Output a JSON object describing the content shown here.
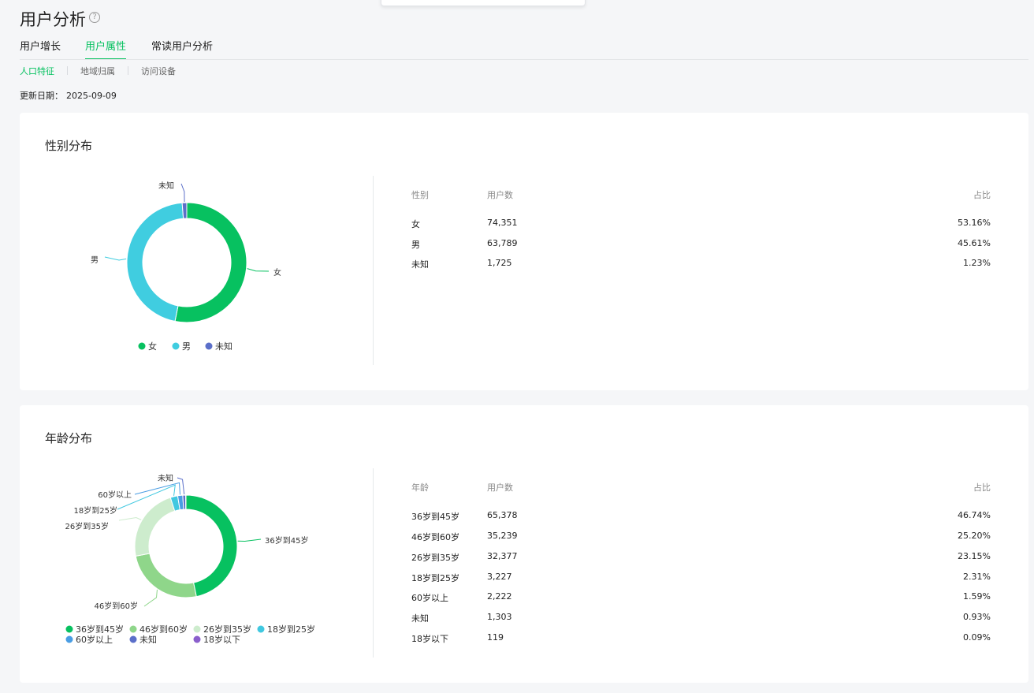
{
  "page": {
    "title": "用户分析",
    "help_icon": "?"
  },
  "tabs": [
    {
      "label": "用户增长"
    },
    {
      "label": "用户属性",
      "active": true
    },
    {
      "label": "常读用户分析"
    }
  ],
  "subtabs": [
    {
      "label": "人口特征",
      "active": true
    },
    {
      "label": "地域归属"
    },
    {
      "label": "访问设备"
    }
  ],
  "update": {
    "label": "更新日期：",
    "date": "2025-09-09"
  },
  "gender": {
    "title": "性别分布",
    "headers": {
      "category": "性别",
      "users": "用户数",
      "ratio": "占比"
    },
    "rows": [
      {
        "label": "女",
        "users": "74,351",
        "ratio": "53.16%"
      },
      {
        "label": "男",
        "users": "63,789",
        "ratio": "45.61%"
      },
      {
        "label": "未知",
        "users": "1,725",
        "ratio": "1.23%"
      }
    ]
  },
  "age": {
    "title": "年龄分布",
    "headers": {
      "category": "年龄",
      "users": "用户数",
      "ratio": "占比"
    },
    "rows": [
      {
        "label": "36岁到45岁",
        "users": "65,378",
        "ratio": "46.74%"
      },
      {
        "label": "46岁到60岁",
        "users": "35,239",
        "ratio": "25.20%"
      },
      {
        "label": "26岁到35岁",
        "users": "32,377",
        "ratio": "23.15%"
      },
      {
        "label": "18岁到25岁",
        "users": "3,227",
        "ratio": "2.31%"
      },
      {
        "label": "60岁以上",
        "users": "2,222",
        "ratio": "1.59%"
      },
      {
        "label": "未知",
        "users": "1,303",
        "ratio": "0.93%"
      },
      {
        "label": "18岁以下",
        "users": "119",
        "ratio": "0.09%"
      }
    ]
  },
  "chart_data": [
    {
      "type": "pie",
      "donut": true,
      "title": "性别分布",
      "categories": [
        "女",
        "男",
        "未知"
      ],
      "values": [
        74351,
        63789,
        1725
      ],
      "colors": [
        "#07c160",
        "#40cde0",
        "#5b6fc9"
      ],
      "legend": "bottom"
    },
    {
      "type": "pie",
      "donut": true,
      "title": "年龄分布",
      "categories": [
        "36岁到45岁",
        "46岁到60岁",
        "26岁到35岁",
        "18岁到25岁",
        "60岁以上",
        "未知",
        "18岁以下"
      ],
      "values": [
        65378,
        35239,
        32377,
        3227,
        2222,
        1303,
        119
      ],
      "colors": [
        "#07c160",
        "#8fd68a",
        "#cdeccd",
        "#40c8e0",
        "#4a9de3",
        "#5b6fc9",
        "#8a5fcc"
      ],
      "legend": "bottom"
    }
  ]
}
